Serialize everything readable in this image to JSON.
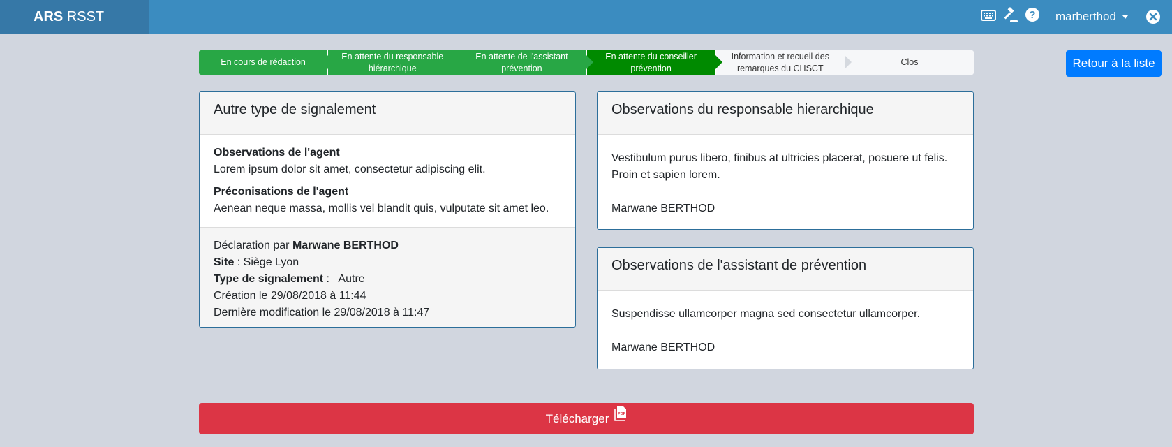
{
  "app": {
    "brand_bold": "ARS",
    "brand_rest": " RSST"
  },
  "navbar": {
    "icons": [
      "keyboard-icon",
      "gavel-icon",
      "help-icon",
      "close-icon"
    ],
    "username": "marberthod"
  },
  "workflow": {
    "steps": [
      {
        "label": "En cours de rédaction",
        "state": "done"
      },
      {
        "label": "En attente du responsable hiérarchique",
        "state": "done"
      },
      {
        "label": "En attente de l'assistant prévention",
        "state": "done"
      },
      {
        "label": "En attente du conseiller prévention",
        "state": "current"
      },
      {
        "label": "Information et recueil des remarques du CHSCT",
        "state": "todo"
      },
      {
        "label": "Clos",
        "state": "todo"
      }
    ]
  },
  "back_button": "Retour à la liste",
  "report_card": {
    "title": "Autre type de signalement",
    "observations_label": "Observations de l'agent",
    "observations_text": "Lorem ipsum dolor sit amet, consectetur adipiscing elit.",
    "recommendations_label": "Préconisations de l'agent",
    "recommendations_text": "Aenean neque massa, mollis vel blandit quis, vulputate sit amet leo.",
    "declared_by_prefix": "Déclaration par ",
    "declared_by": "Marwane BERTHOD",
    "site_label": "Site",
    "site_value": " : Siège Lyon",
    "type_label": "Type de signalement",
    "type_value": " :   Autre",
    "created": "Création le 29/08/2018 à 11:44",
    "modified": "Dernière modification le 29/08/2018 à 11:47"
  },
  "manager_card": {
    "title": "Observations du responsable hierarchique",
    "text": "Vestibulum purus libero, finibus at ultricies placerat, posuere ut felis. Proin et sapien lorem.",
    "author": "Marwane BERTHOD"
  },
  "assistant_card": {
    "title": "Observations de l'assistant de prévention",
    "text": "Suspendisse ullamcorper magna sed consectetur ullamcorper.",
    "author": "Marwane BERTHOD"
  },
  "download_button": "Télécharger",
  "colors": {
    "topbar": "#3b8cc0",
    "brand_bg": "#3678a7",
    "step_done": "#28a745",
    "step_current": "#008a00",
    "primary": "#007bff",
    "danger": "#dc3545",
    "card_border": "#2c6e9a"
  }
}
